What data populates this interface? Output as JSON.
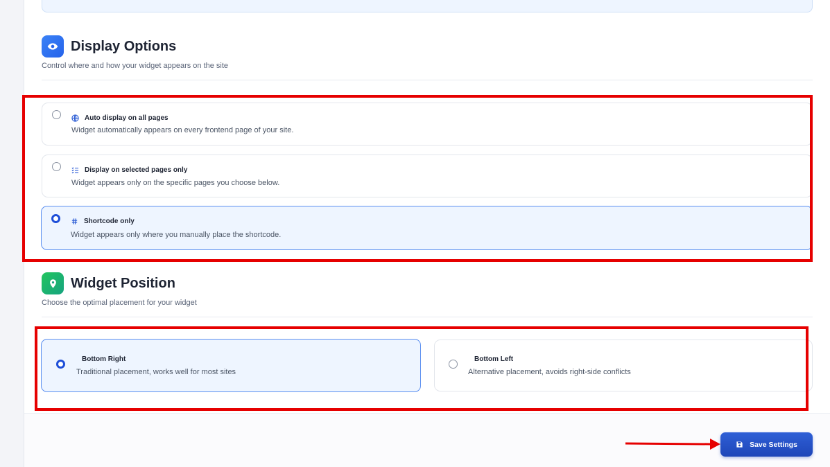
{
  "display_options": {
    "title": "Display Options",
    "subtitle": "Control where and how your widget appears on the site",
    "icon": "eye-icon",
    "options": [
      {
        "label": "Auto display on all pages",
        "description": "Widget automatically appears on every frontend page of your site.",
        "icon": "globe-icon",
        "selected": false
      },
      {
        "label": "Display on selected pages only",
        "description": "Widget appears only on the specific pages you choose below.",
        "icon": "list-check-icon",
        "selected": false
      },
      {
        "label": "Shortcode only",
        "description": "Widget appears only where you manually place the shortcode.",
        "icon": "hash-icon",
        "selected": true
      }
    ]
  },
  "widget_position": {
    "title": "Widget Position",
    "subtitle": "Choose the optimal placement for your widget",
    "icon": "map-pin-icon",
    "options": [
      {
        "label": "Bottom Right",
        "description": "Traditional placement, works well for most sites",
        "selected": true
      },
      {
        "label": "Bottom Left",
        "description": "Alternative placement, avoids right-side conflicts",
        "selected": false
      }
    ]
  },
  "footer": {
    "save_label": "Save Settings",
    "save_icon": "floppy-disk-icon"
  },
  "colors": {
    "accent": "#1d4ed8",
    "selected_bg": "#eef5ff",
    "highlight_red": "#e60000",
    "green_icon": "#16a37f"
  }
}
